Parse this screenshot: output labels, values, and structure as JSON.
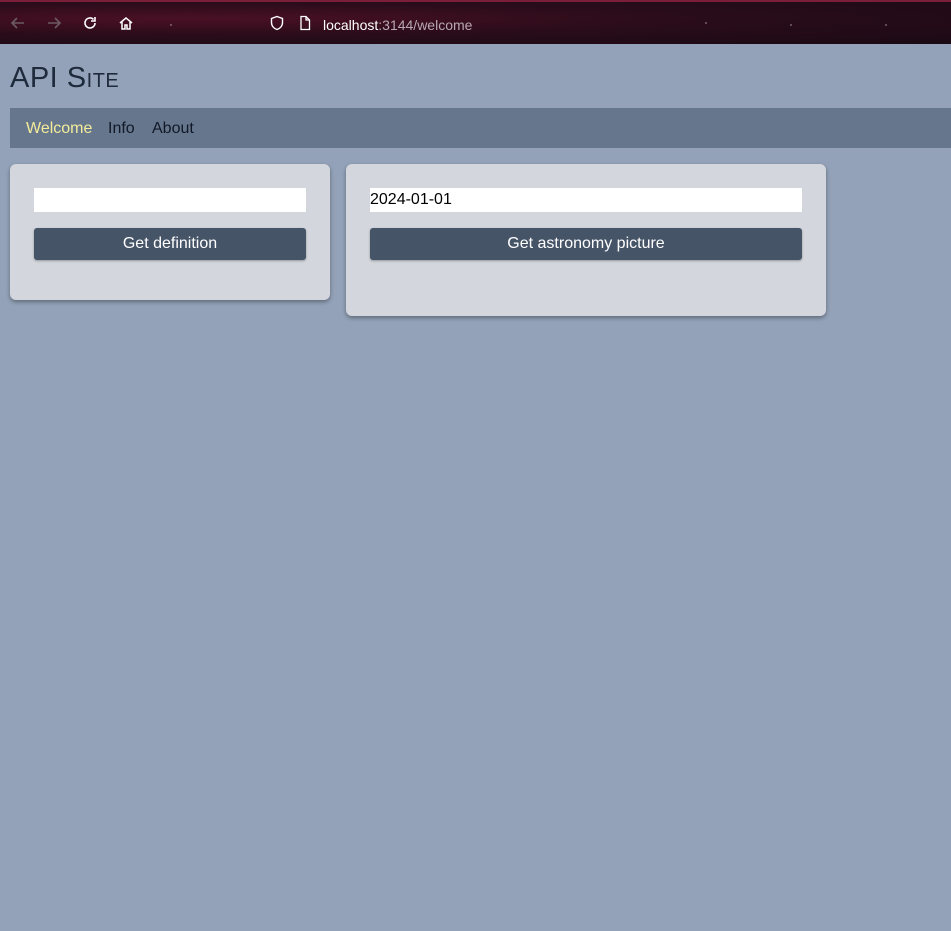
{
  "browser": {
    "url_host": "localhost",
    "url_path": ":3144/welcome",
    "icons": [
      "back-arrow-icon",
      "forward-arrow-icon",
      "reload-icon",
      "home-icon",
      "shield-icon",
      "page-icon"
    ]
  },
  "site": {
    "title": "API Site"
  },
  "nav": {
    "items": [
      {
        "label": "Welcome",
        "active": true
      },
      {
        "label": "Info",
        "active": false
      },
      {
        "label": "About",
        "active": false
      }
    ]
  },
  "definition_card": {
    "input_value": "",
    "button_label": "Get definition"
  },
  "astronomy_card": {
    "input_value": "2024-01-01",
    "button_label": "Get astronomy picture"
  },
  "colors": {
    "page_background": "#93a2b8",
    "nav_background": "#66768d",
    "nav_active": "#f3ec9a",
    "card_background": "#d3d6dc",
    "button_background": "#465467"
  }
}
